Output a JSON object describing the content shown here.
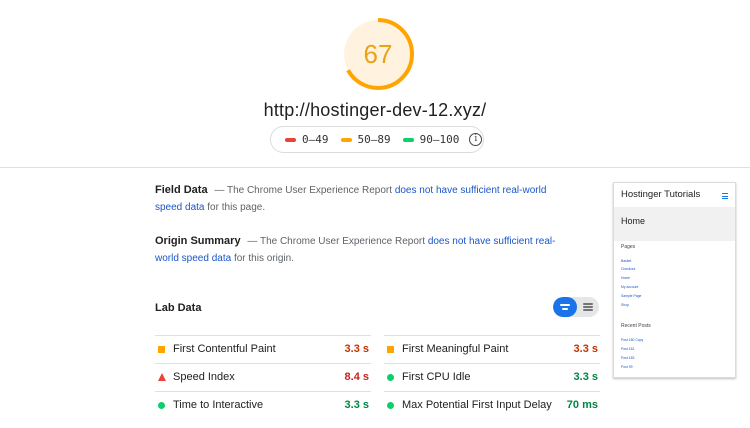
{
  "header": {
    "score": "67",
    "score_fraction": 0.67,
    "score_color": "#ffa400",
    "url": "http://hostinger-dev-12.xyz/"
  },
  "legend": {
    "items": [
      {
        "label": "0–49",
        "color": "#eb4335"
      },
      {
        "label": "50–89",
        "color": "#ffa400"
      },
      {
        "label": "90–100",
        "color": "#0cce6b"
      }
    ],
    "info_icon": "info-icon"
  },
  "field_data": {
    "title": "Field Data",
    "text_pre": " — The Chrome User Experience Report ",
    "link": "does not have sufficient real-world speed data",
    "text_post": " for this page."
  },
  "origin_summary": {
    "title": "Origin Summary",
    "text_pre": " — The Chrome User Experience Report ",
    "link": "does not have sufficient real-world speed data",
    "text_post": " for this origin."
  },
  "lab_data": {
    "title": "Lab Data",
    "metrics": [
      {
        "label": "First Contentful Paint",
        "value": "3.3 s",
        "status": "average",
        "icon": "orange-square-icon",
        "value_color": "#c33300"
      },
      {
        "label": "First Meaningful Paint",
        "value": "3.3 s",
        "status": "average",
        "icon": "orange-square-icon",
        "value_color": "#c33300"
      },
      {
        "label": "Speed Index",
        "value": "8.4 s",
        "status": "fail",
        "icon": "red-triangle-icon",
        "value_color": "#c7221f"
      },
      {
        "label": "First CPU Idle",
        "value": "3.3 s",
        "status": "pass",
        "icon": "green-circle-icon",
        "value_color": "#018642"
      },
      {
        "label": "Time to Interactive",
        "value": "3.3 s",
        "status": "pass",
        "icon": "green-circle-icon",
        "value_color": "#018642"
      },
      {
        "label": "Max Potential First Input Delay",
        "value": "70 ms",
        "status": "pass",
        "icon": "green-circle-icon",
        "value_color": "#018642"
      }
    ]
  },
  "thumbnail": {
    "site_title": "Hostinger Tutorials",
    "home": "Home",
    "pages_heading": "Pages",
    "pages": [
      "Basket",
      "Checkout",
      "Home",
      "My account",
      "Sample Page",
      "Shop"
    ],
    "recent_heading": "Recent Posts",
    "recent": [
      "Post 180 Copy",
      "Post 181",
      "Post 183",
      "Post 99"
    ]
  }
}
